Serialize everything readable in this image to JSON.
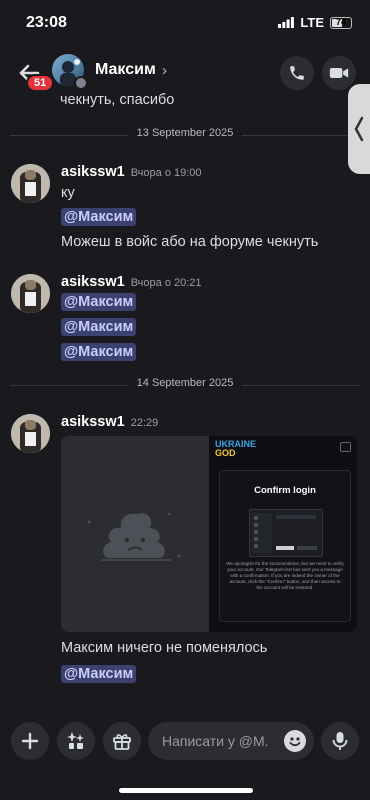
{
  "status_bar": {
    "time": "23:08",
    "network": "LTE",
    "battery": "74"
  },
  "header": {
    "unread_badge": "51",
    "name": "Максим",
    "chevron": "›"
  },
  "messages": {
    "previous_tail": "чекнуть, спасибо",
    "dividers": [
      "13 September 2025",
      "14 September 2025"
    ],
    "groups": [
      {
        "author": "asikssw1",
        "time": "Вчора о 19:00",
        "lines": [
          "ку"
        ],
        "mention": "@Максим",
        "after": "Можеш в войс або на форуме чекнуть"
      },
      {
        "author": "asikssw1",
        "time": "Вчора о 20:21",
        "mentions": [
          "@Максим",
          "@Максим",
          "@Максим"
        ]
      },
      {
        "author": "asikssw1",
        "time": "22:29",
        "attachment": {
          "logo_line1": "UKRAINE",
          "logo_line2": "GOD",
          "confirm_title": "Confirm login",
          "confirm_text": "We apologize for the inconvenience, but we need to verify your account. Our Telegram-bot has sent you a message with a confirmation. If you are indeed the owner of the account, click the \"Confirm\" button, and then access to the account will be restored."
        },
        "text": "Максим ничего не поменялось",
        "mention": "@Максим"
      }
    ]
  },
  "composer": {
    "placeholder": "Написати у @М..."
  },
  "colors": {
    "accent": "#5865f2",
    "mention_bg": "#3c4270",
    "badge": "#e5323c"
  }
}
